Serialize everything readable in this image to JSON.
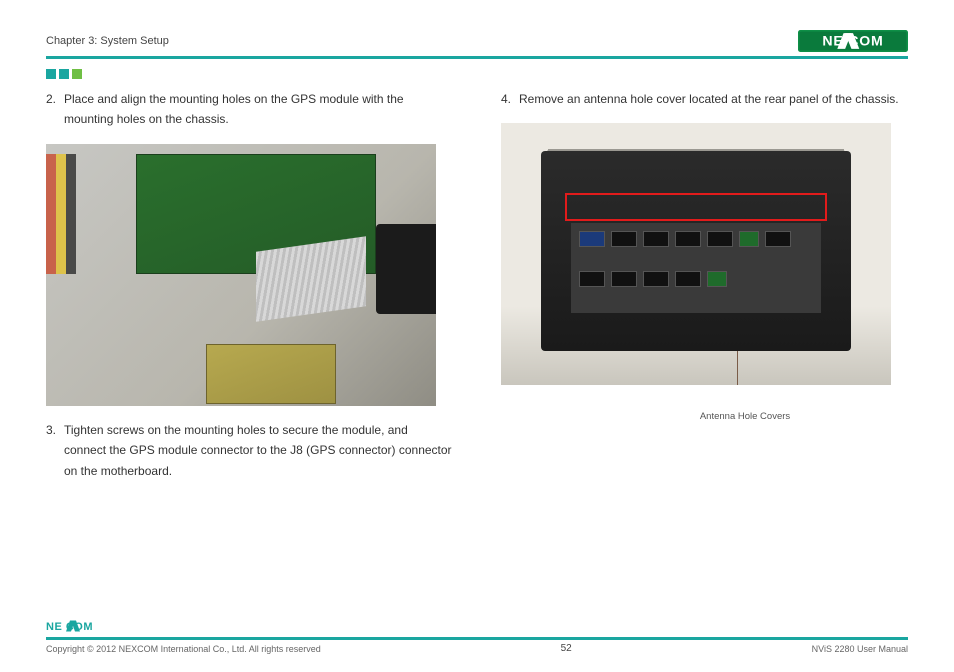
{
  "header": {
    "chapter": "Chapter 3: System Setup",
    "logo_text": "NEXCOM"
  },
  "left_column": {
    "step2_num": "2.",
    "step2_text": "Place and align the mounting holes on the GPS module with the mounting holes on the chassis.",
    "step3_num": "3.",
    "step3_text": "Tighten screws on the mounting holes to secure the module, and connect the GPS module connector to the J8 (GPS connector) connector on the motherboard."
  },
  "right_column": {
    "step4_num": "4.",
    "step4_text": "Remove an antenna hole cover located at the rear panel of the chassis.",
    "caption": "Antenna Hole Covers"
  },
  "footer": {
    "logo_text": "NEXCOM",
    "copyright": "Copyright © 2012 NEXCOM International Co., Ltd. All rights reserved",
    "page_number": "52",
    "doc_title": "NViS 2280 User Manual"
  }
}
